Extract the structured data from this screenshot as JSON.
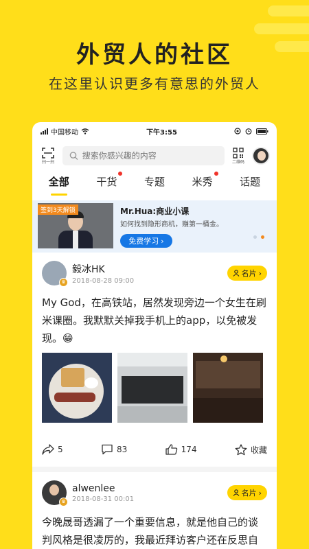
{
  "promo": {
    "headline": "外贸人的社区",
    "subline": "在这里认识更多有意思的外贸人"
  },
  "status_bar": {
    "carrier": "中国移动",
    "time": "下午3:55"
  },
  "search": {
    "scan_label": "扫一扫",
    "placeholder": "搜索你感兴趣的内容",
    "qr_label": "二维码"
  },
  "tabs": [
    {
      "label": "全部",
      "active": true,
      "dot": false
    },
    {
      "label": "干货",
      "active": false,
      "dot": true
    },
    {
      "label": "专题",
      "active": false,
      "dot": false
    },
    {
      "label": "米秀",
      "active": false,
      "dot": true
    },
    {
      "label": "话题",
      "active": false,
      "dot": false
    }
  ],
  "banner": {
    "tag": "签到3天解锁",
    "title": "Mr.Hua:商业小课",
    "desc": "如何找到隐形商机，赚第一桶金。",
    "button": "免费学习"
  },
  "posts": [
    {
      "name": "毅冰HK",
      "time": "2018-08-28 09:00",
      "card_btn": "名片",
      "text": "My God，在高铁站，居然发现旁边一个女生在刷米课圈。我默默关掉我手机上的app，以免被发现。😁",
      "shares": "5",
      "comments": "83",
      "likes": "174",
      "fav": "收藏"
    },
    {
      "name": "alwenlee",
      "time": "2018-08-31 00:01",
      "card_btn": "名片",
      "text": "今晚晟哥透漏了一个重要信息，就是他自己的谈判风格是很凌厉的，我最近拜访客户还在反思自己是不是太过..."
    }
  ],
  "colors": {
    "background": "#FFDE1A",
    "accent": "#FFD400",
    "badge_dot": "#F0332A",
    "banner_button": "#1677E5"
  }
}
